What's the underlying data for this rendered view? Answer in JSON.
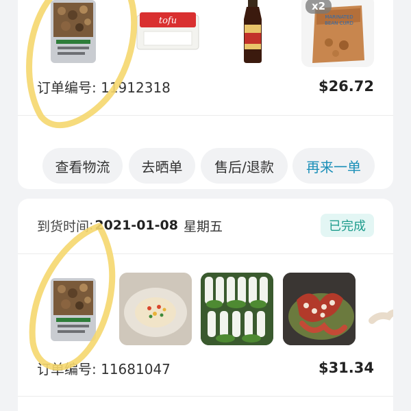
{
  "orders": [
    {
      "items": [
        {
          "icon": "mushroom-bag-product-image"
        },
        {
          "icon": "tofu-package-product-image"
        },
        {
          "icon": "soy-sauce-bottle-product-image"
        },
        {
          "icon": "bean-curd-bag-product-image",
          "quantity_badge": "x2"
        }
      ],
      "order_number_label": "订单编号",
      "order_number": "11912318",
      "total": "$26.72",
      "actions": [
        {
          "label": "查看物流"
        },
        {
          "label": "去晒单"
        },
        {
          "label": "售后/退款"
        },
        {
          "label": "再来一单",
          "accent": true
        }
      ]
    },
    {
      "delivery_label": "到货时间",
      "delivery_date": "2021-01-08",
      "delivery_weekday": "星期五",
      "status": "已完成",
      "items": [
        {
          "icon": "mushroom-bag-product-image"
        },
        {
          "icon": "scallop-dish-product-image"
        },
        {
          "icon": "bok-choy-product-image"
        },
        {
          "icon": "octopus-dish-product-image"
        }
      ],
      "order_number_label": "订单编号",
      "order_number": "11681047",
      "total": "$31.34"
    }
  ],
  "colors": {
    "accent": "#1a8fb8",
    "status_bg": "#e3f6f4",
    "status_text": "#1f9c8d",
    "annotation": "#f5d76e"
  }
}
